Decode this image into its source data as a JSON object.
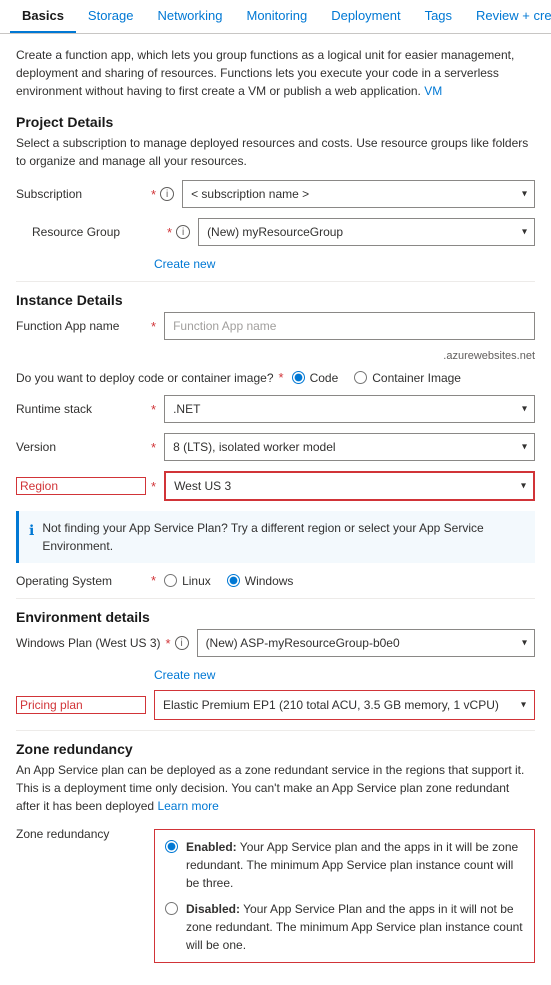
{
  "tabs": [
    {
      "label": "Basics",
      "active": true
    },
    {
      "label": "Storage",
      "active": false
    },
    {
      "label": "Networking",
      "active": false
    },
    {
      "label": "Monitoring",
      "active": false
    },
    {
      "label": "Deployment",
      "active": false
    },
    {
      "label": "Tags",
      "active": false
    },
    {
      "label": "Review + create",
      "active": false
    }
  ],
  "description": "Create a function app, which lets you group functions as a logical unit for easier management, deployment and sharing of resources. Functions lets you execute your code in a serverless environment without having to first create a VM or publish a web application.",
  "description_vm_link": "VM",
  "projectDetails": {
    "title": "Project Details",
    "desc": "Select a subscription to manage deployed resources and costs. Use resource groups like folders to organize and manage all your resources.",
    "subscriptionLabel": "Subscription",
    "subscriptionPlaceholder": "< subscription name >",
    "resourceGroupLabel": "Resource Group",
    "resourceGroupValue": "(New) myResourceGroup",
    "createNew": "Create new"
  },
  "instanceDetails": {
    "title": "Instance Details",
    "functionAppNameLabel": "Function App name",
    "functionAppNamePlaceholder": "Function App name",
    "azureSuffix": ".azurewebsites.net",
    "deployLabel": "Do you want to deploy code or container image?",
    "codeOption": "Code",
    "containerOption": "Container Image",
    "runtimeStackLabel": "Runtime stack",
    "runtimeStackValue": ".NET",
    "versionLabel": "Version",
    "versionValue": "8 (LTS), isolated worker model",
    "regionLabel": "Region",
    "regionValue": "West US 3",
    "regionInfoText": "Not finding your App Service Plan? Try a different region or select your App Service Environment.",
    "osLabel": "Operating System",
    "linuxOption": "Linux",
    "windowsOption": "Windows"
  },
  "environmentDetails": {
    "title": "Environment details",
    "windowsPlanLabel": "Windows Plan (West US 3)",
    "windowsPlanValue": "(New) ASP-myResourceGroup-b0e0",
    "createNew": "Create new",
    "pricingPlanLabel": "Pricing plan",
    "pricingPlanValue": "Elastic Premium EP1 (210 total ACU, 3.5 GB memory, 1 vCPU)"
  },
  "zoneRedundancy": {
    "title": "Zone redundancy",
    "desc": "An App Service plan can be deployed as a zone redundant service in the regions that support it. This is a deployment time only decision. You can't make an App Service plan zone redundant after it has been deployed",
    "learnMore": "Learn more",
    "enabledLabel": "Enabled:",
    "enabledDesc": "Your App Service plan and the apps in it will be zone redundant. The minimum App Service plan instance count will be three.",
    "disabledLabel": "Disabled:",
    "disabledDesc": "Your App Service Plan and the apps in it will not be zone redundant. The minimum App Service plan instance count will be one."
  }
}
